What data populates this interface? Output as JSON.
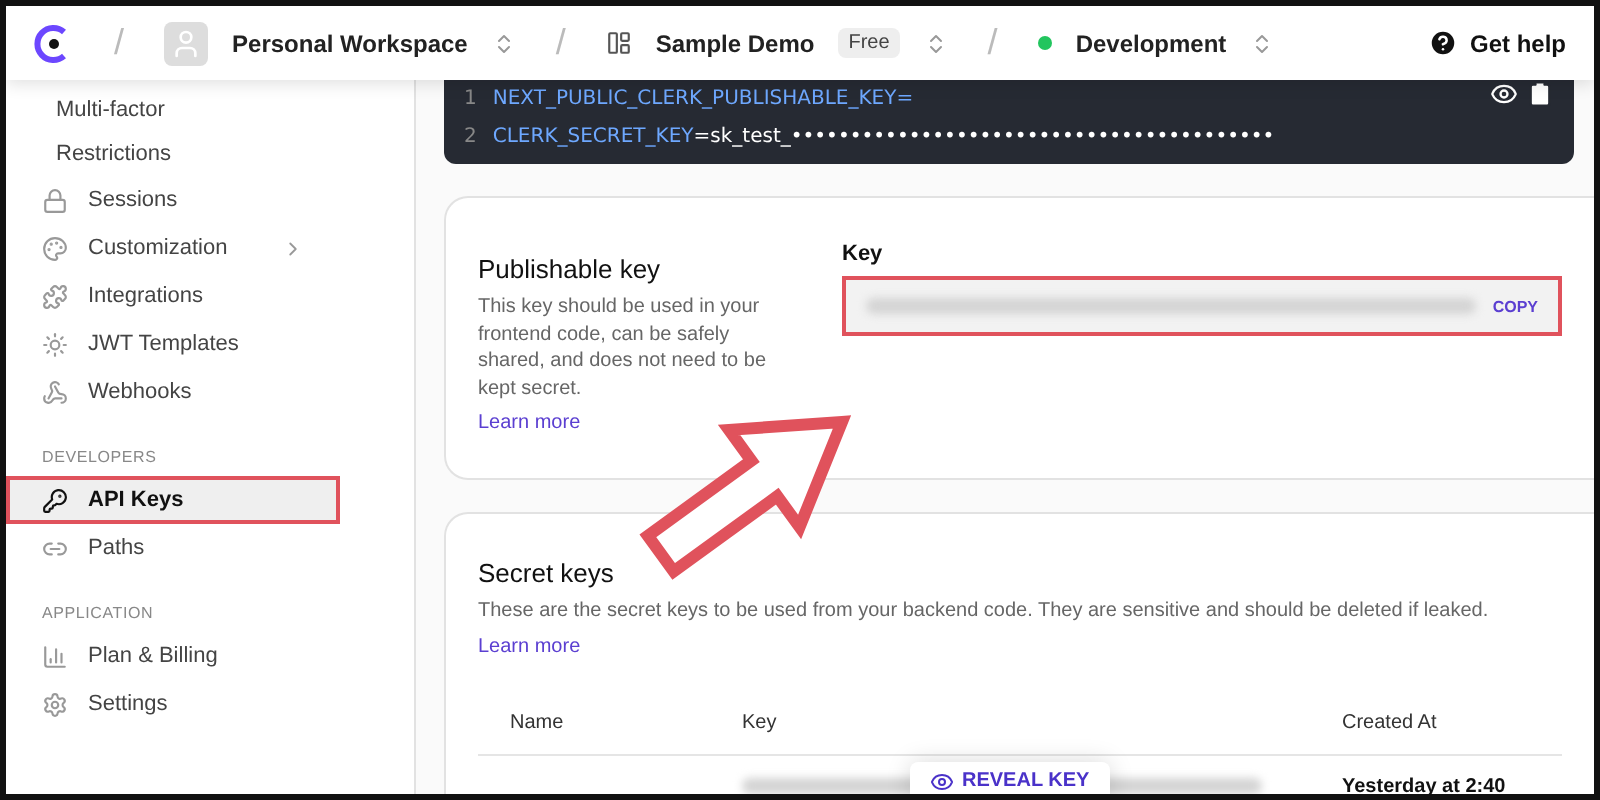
{
  "header": {
    "workspace": "Personal Workspace",
    "app": "Sample Demo",
    "plan_badge": "Free",
    "environment": "Development",
    "help": "Get help",
    "separators": [
      "/",
      "/",
      "/"
    ]
  },
  "sidebar": {
    "subitems": [
      "Multi-factor",
      "Restrictions"
    ],
    "items": [
      {
        "label": "Sessions",
        "selected": false
      },
      {
        "label": "Customization",
        "selected": false,
        "expandable": true
      },
      {
        "label": "Integrations",
        "selected": false
      },
      {
        "label": "JWT Templates",
        "selected": false
      },
      {
        "label": "Webhooks",
        "selected": false
      }
    ],
    "sections": [
      {
        "heading": "DEVELOPERS",
        "items": [
          {
            "label": "API Keys",
            "selected": true,
            "highlighted": true
          },
          {
            "label": "Paths",
            "selected": false
          }
        ]
      },
      {
        "heading": "APPLICATION",
        "items": [
          {
            "label": "Plan & Billing",
            "selected": false
          },
          {
            "label": "Settings",
            "selected": false
          }
        ]
      }
    ]
  },
  "code_block": {
    "lines": [
      {
        "number": "1",
        "name": "NEXT_PUBLIC_CLERK_PUBLISHABLE_KEY",
        "equals": "="
      },
      {
        "number": "2",
        "name": "CLERK_SECRET_KEY",
        "equals": "=",
        "value": "sk_test_•••••••••••••••••••••••••••••••••••••••••"
      }
    ]
  },
  "publishable": {
    "title": "Publishable key",
    "description": "This key should be used in your frontend code, can be safely shared, and does not need to be kept secret.",
    "link": "Learn more",
    "field_label": "Key",
    "copy": "COPY",
    "highlighted": true
  },
  "secret": {
    "title": "Secret keys",
    "description": "These are the secret keys to be used from your backend code. They are sensitive and should be deleted if leaked.",
    "link": "Learn more",
    "table": {
      "columns": [
        "Name",
        "Key",
        "Created At"
      ],
      "rows": [
        {
          "reveal": "REVEAL KEY",
          "created": "Yesterday at 2:40"
        }
      ]
    }
  }
}
